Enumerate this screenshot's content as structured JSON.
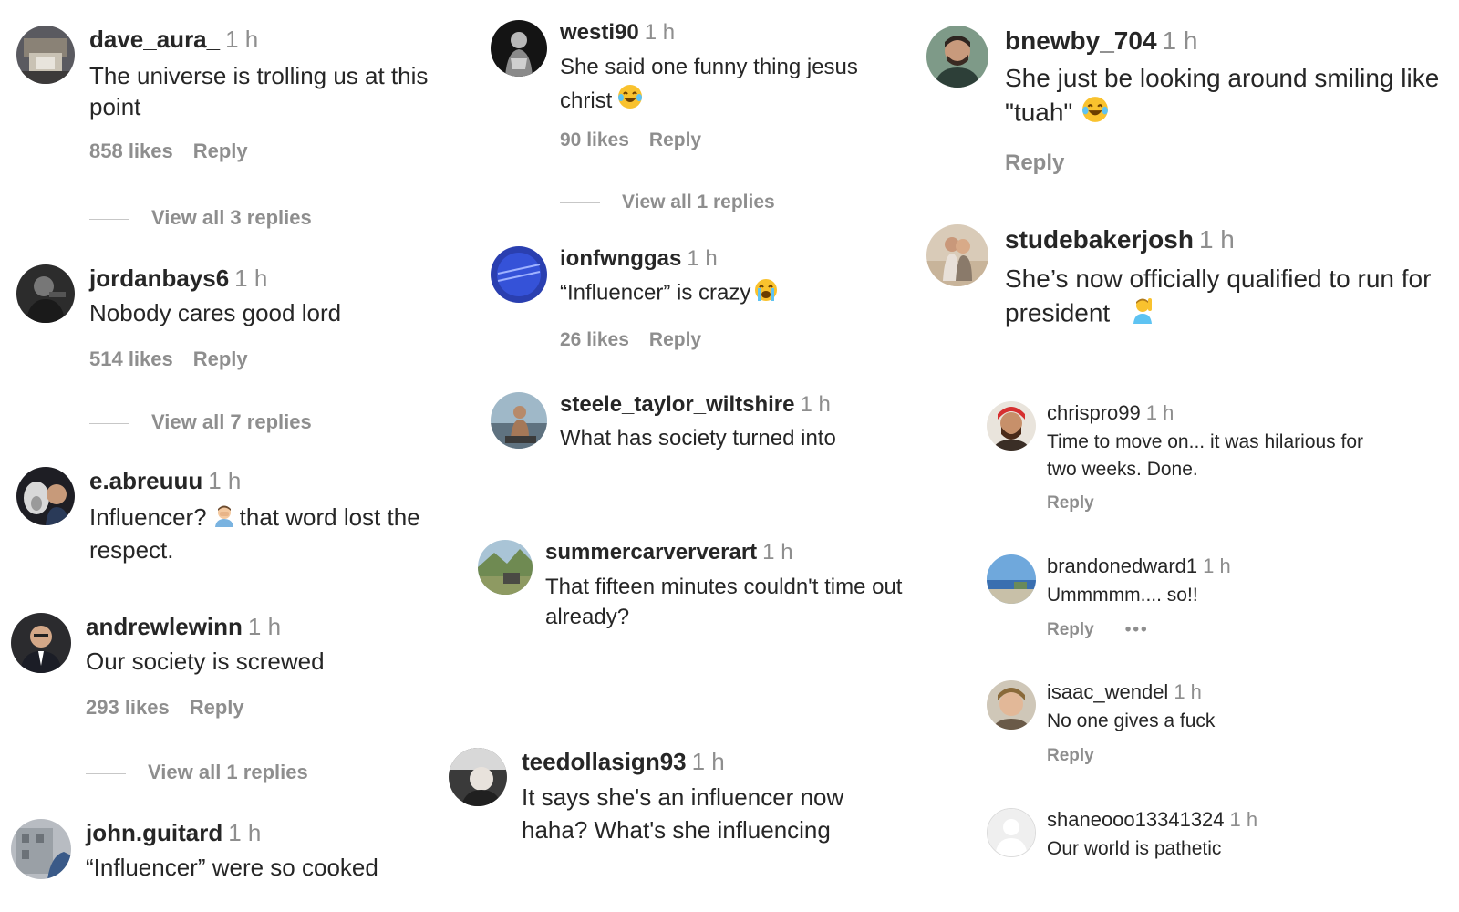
{
  "comments": {
    "dave": {
      "username": "dave_aura_",
      "time": "1 h",
      "text": "The universe is trolling us at this point",
      "likes": "858 likes",
      "reply": "Reply",
      "view_replies": "View all 3 replies"
    },
    "jordan": {
      "username": "jordanbays6",
      "time": "1 h",
      "text": "Nobody cares good lord",
      "likes": "514 likes",
      "reply": "Reply",
      "view_replies": "View all 7 replies"
    },
    "eabreu": {
      "username": "e.abreuuu",
      "time": "1 h",
      "text_before": "Influencer?",
      "text_after": "that word lost the respect.",
      "emoji": "man-facepalming"
    },
    "andrew": {
      "username": "andrewlewinn",
      "time": "1 h",
      "text": "Our society is screwed",
      "likes": "293 likes",
      "reply": "Reply",
      "view_replies": "View all 1 replies"
    },
    "john": {
      "username": "john.guitard",
      "time": "1 h",
      "text": "“Influencer” were so cooked"
    },
    "westi": {
      "username": "westi90",
      "time": "1 h",
      "text": "She said one funny thing jesus christ",
      "emoji": "face-with-tears-of-joy",
      "likes": "90 likes",
      "reply": "Reply",
      "view_replies": "View all 1 replies"
    },
    "ionf": {
      "username": "ionfwnggas",
      "time": "1 h",
      "text": "“Influencer” is crazy",
      "emoji": "loudly-crying-face",
      "likes": "26 likes",
      "reply": "Reply"
    },
    "steele": {
      "username": "steele_taylor_wiltshire",
      "time": "1 h",
      "text": "What has society turned into"
    },
    "summer": {
      "username": "summercarververart",
      "time": "1 h",
      "text": "That fifteen minutes couldn't time out already?"
    },
    "tee": {
      "username": "teedollasign93",
      "time": "1 h",
      "text": "It says she's an influencer now haha? What's she influencing"
    },
    "bnewby": {
      "username": "bnewby_704",
      "time": "1 h",
      "text": "She just be looking around smiling like \"tuah\"",
      "emoji": "face-with-tears-of-joy",
      "reply": "Reply"
    },
    "stude": {
      "username": "studebakerjosh",
      "time": "1 h",
      "text": "She’s now officially qualified to run for president",
      "emoji": "person-raising-hand"
    },
    "chris": {
      "username": "chrispro99",
      "time": "1 h",
      "text": "Time to move on... it was hilarious for two weeks. Done.",
      "reply": "Reply"
    },
    "brandon": {
      "username": "brandonedward1",
      "time": "1 h",
      "text": "Ummmmm.... so!!",
      "reply": "Reply",
      "more": "•••"
    },
    "isaac": {
      "username": "isaac_wendel",
      "time": "1 h",
      "text": "No one gives a fuck",
      "reply": "Reply"
    },
    "shane": {
      "username": "shaneooo13341324",
      "time": "1 h",
      "text": "Our world is pathetic"
    }
  },
  "colors": {
    "text": "#262626",
    "secondary": "#8e8e8e",
    "divider": "#c7c7c7",
    "background": "#ffffff"
  }
}
